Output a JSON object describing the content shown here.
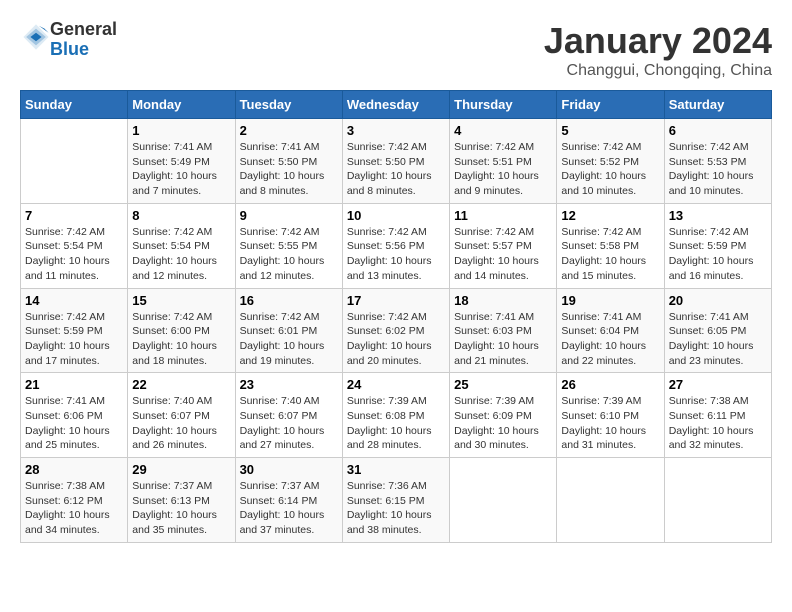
{
  "header": {
    "logo_general": "General",
    "logo_blue": "Blue",
    "month_title": "January 2024",
    "location": "Changgui, Chongqing, China"
  },
  "calendar": {
    "weekdays": [
      "Sunday",
      "Monday",
      "Tuesday",
      "Wednesday",
      "Thursday",
      "Friday",
      "Saturday"
    ],
    "weeks": [
      [
        {
          "day": "",
          "info": ""
        },
        {
          "day": "1",
          "info": "Sunrise: 7:41 AM\nSunset: 5:49 PM\nDaylight: 10 hours\nand 7 minutes."
        },
        {
          "day": "2",
          "info": "Sunrise: 7:41 AM\nSunset: 5:50 PM\nDaylight: 10 hours\nand 8 minutes."
        },
        {
          "day": "3",
          "info": "Sunrise: 7:42 AM\nSunset: 5:50 PM\nDaylight: 10 hours\nand 8 minutes."
        },
        {
          "day": "4",
          "info": "Sunrise: 7:42 AM\nSunset: 5:51 PM\nDaylight: 10 hours\nand 9 minutes."
        },
        {
          "day": "5",
          "info": "Sunrise: 7:42 AM\nSunset: 5:52 PM\nDaylight: 10 hours\nand 10 minutes."
        },
        {
          "day": "6",
          "info": "Sunrise: 7:42 AM\nSunset: 5:53 PM\nDaylight: 10 hours\nand 10 minutes."
        }
      ],
      [
        {
          "day": "7",
          "info": "Sunrise: 7:42 AM\nSunset: 5:54 PM\nDaylight: 10 hours\nand 11 minutes."
        },
        {
          "day": "8",
          "info": "Sunrise: 7:42 AM\nSunset: 5:54 PM\nDaylight: 10 hours\nand 12 minutes."
        },
        {
          "day": "9",
          "info": "Sunrise: 7:42 AM\nSunset: 5:55 PM\nDaylight: 10 hours\nand 12 minutes."
        },
        {
          "day": "10",
          "info": "Sunrise: 7:42 AM\nSunset: 5:56 PM\nDaylight: 10 hours\nand 13 minutes."
        },
        {
          "day": "11",
          "info": "Sunrise: 7:42 AM\nSunset: 5:57 PM\nDaylight: 10 hours\nand 14 minutes."
        },
        {
          "day": "12",
          "info": "Sunrise: 7:42 AM\nSunset: 5:58 PM\nDaylight: 10 hours\nand 15 minutes."
        },
        {
          "day": "13",
          "info": "Sunrise: 7:42 AM\nSunset: 5:59 PM\nDaylight: 10 hours\nand 16 minutes."
        }
      ],
      [
        {
          "day": "14",
          "info": "Sunrise: 7:42 AM\nSunset: 5:59 PM\nDaylight: 10 hours\nand 17 minutes."
        },
        {
          "day": "15",
          "info": "Sunrise: 7:42 AM\nSunset: 6:00 PM\nDaylight: 10 hours\nand 18 minutes."
        },
        {
          "day": "16",
          "info": "Sunrise: 7:42 AM\nSunset: 6:01 PM\nDaylight: 10 hours\nand 19 minutes."
        },
        {
          "day": "17",
          "info": "Sunrise: 7:42 AM\nSunset: 6:02 PM\nDaylight: 10 hours\nand 20 minutes."
        },
        {
          "day": "18",
          "info": "Sunrise: 7:41 AM\nSunset: 6:03 PM\nDaylight: 10 hours\nand 21 minutes."
        },
        {
          "day": "19",
          "info": "Sunrise: 7:41 AM\nSunset: 6:04 PM\nDaylight: 10 hours\nand 22 minutes."
        },
        {
          "day": "20",
          "info": "Sunrise: 7:41 AM\nSunset: 6:05 PM\nDaylight: 10 hours\nand 23 minutes."
        }
      ],
      [
        {
          "day": "21",
          "info": "Sunrise: 7:41 AM\nSunset: 6:06 PM\nDaylight: 10 hours\nand 25 minutes."
        },
        {
          "day": "22",
          "info": "Sunrise: 7:40 AM\nSunset: 6:07 PM\nDaylight: 10 hours\nand 26 minutes."
        },
        {
          "day": "23",
          "info": "Sunrise: 7:40 AM\nSunset: 6:07 PM\nDaylight: 10 hours\nand 27 minutes."
        },
        {
          "day": "24",
          "info": "Sunrise: 7:39 AM\nSunset: 6:08 PM\nDaylight: 10 hours\nand 28 minutes."
        },
        {
          "day": "25",
          "info": "Sunrise: 7:39 AM\nSunset: 6:09 PM\nDaylight: 10 hours\nand 30 minutes."
        },
        {
          "day": "26",
          "info": "Sunrise: 7:39 AM\nSunset: 6:10 PM\nDaylight: 10 hours\nand 31 minutes."
        },
        {
          "day": "27",
          "info": "Sunrise: 7:38 AM\nSunset: 6:11 PM\nDaylight: 10 hours\nand 32 minutes."
        }
      ],
      [
        {
          "day": "28",
          "info": "Sunrise: 7:38 AM\nSunset: 6:12 PM\nDaylight: 10 hours\nand 34 minutes."
        },
        {
          "day": "29",
          "info": "Sunrise: 7:37 AM\nSunset: 6:13 PM\nDaylight: 10 hours\nand 35 minutes."
        },
        {
          "day": "30",
          "info": "Sunrise: 7:37 AM\nSunset: 6:14 PM\nDaylight: 10 hours\nand 37 minutes."
        },
        {
          "day": "31",
          "info": "Sunrise: 7:36 AM\nSunset: 6:15 PM\nDaylight: 10 hours\nand 38 minutes."
        },
        {
          "day": "",
          "info": ""
        },
        {
          "day": "",
          "info": ""
        },
        {
          "day": "",
          "info": ""
        }
      ]
    ]
  }
}
